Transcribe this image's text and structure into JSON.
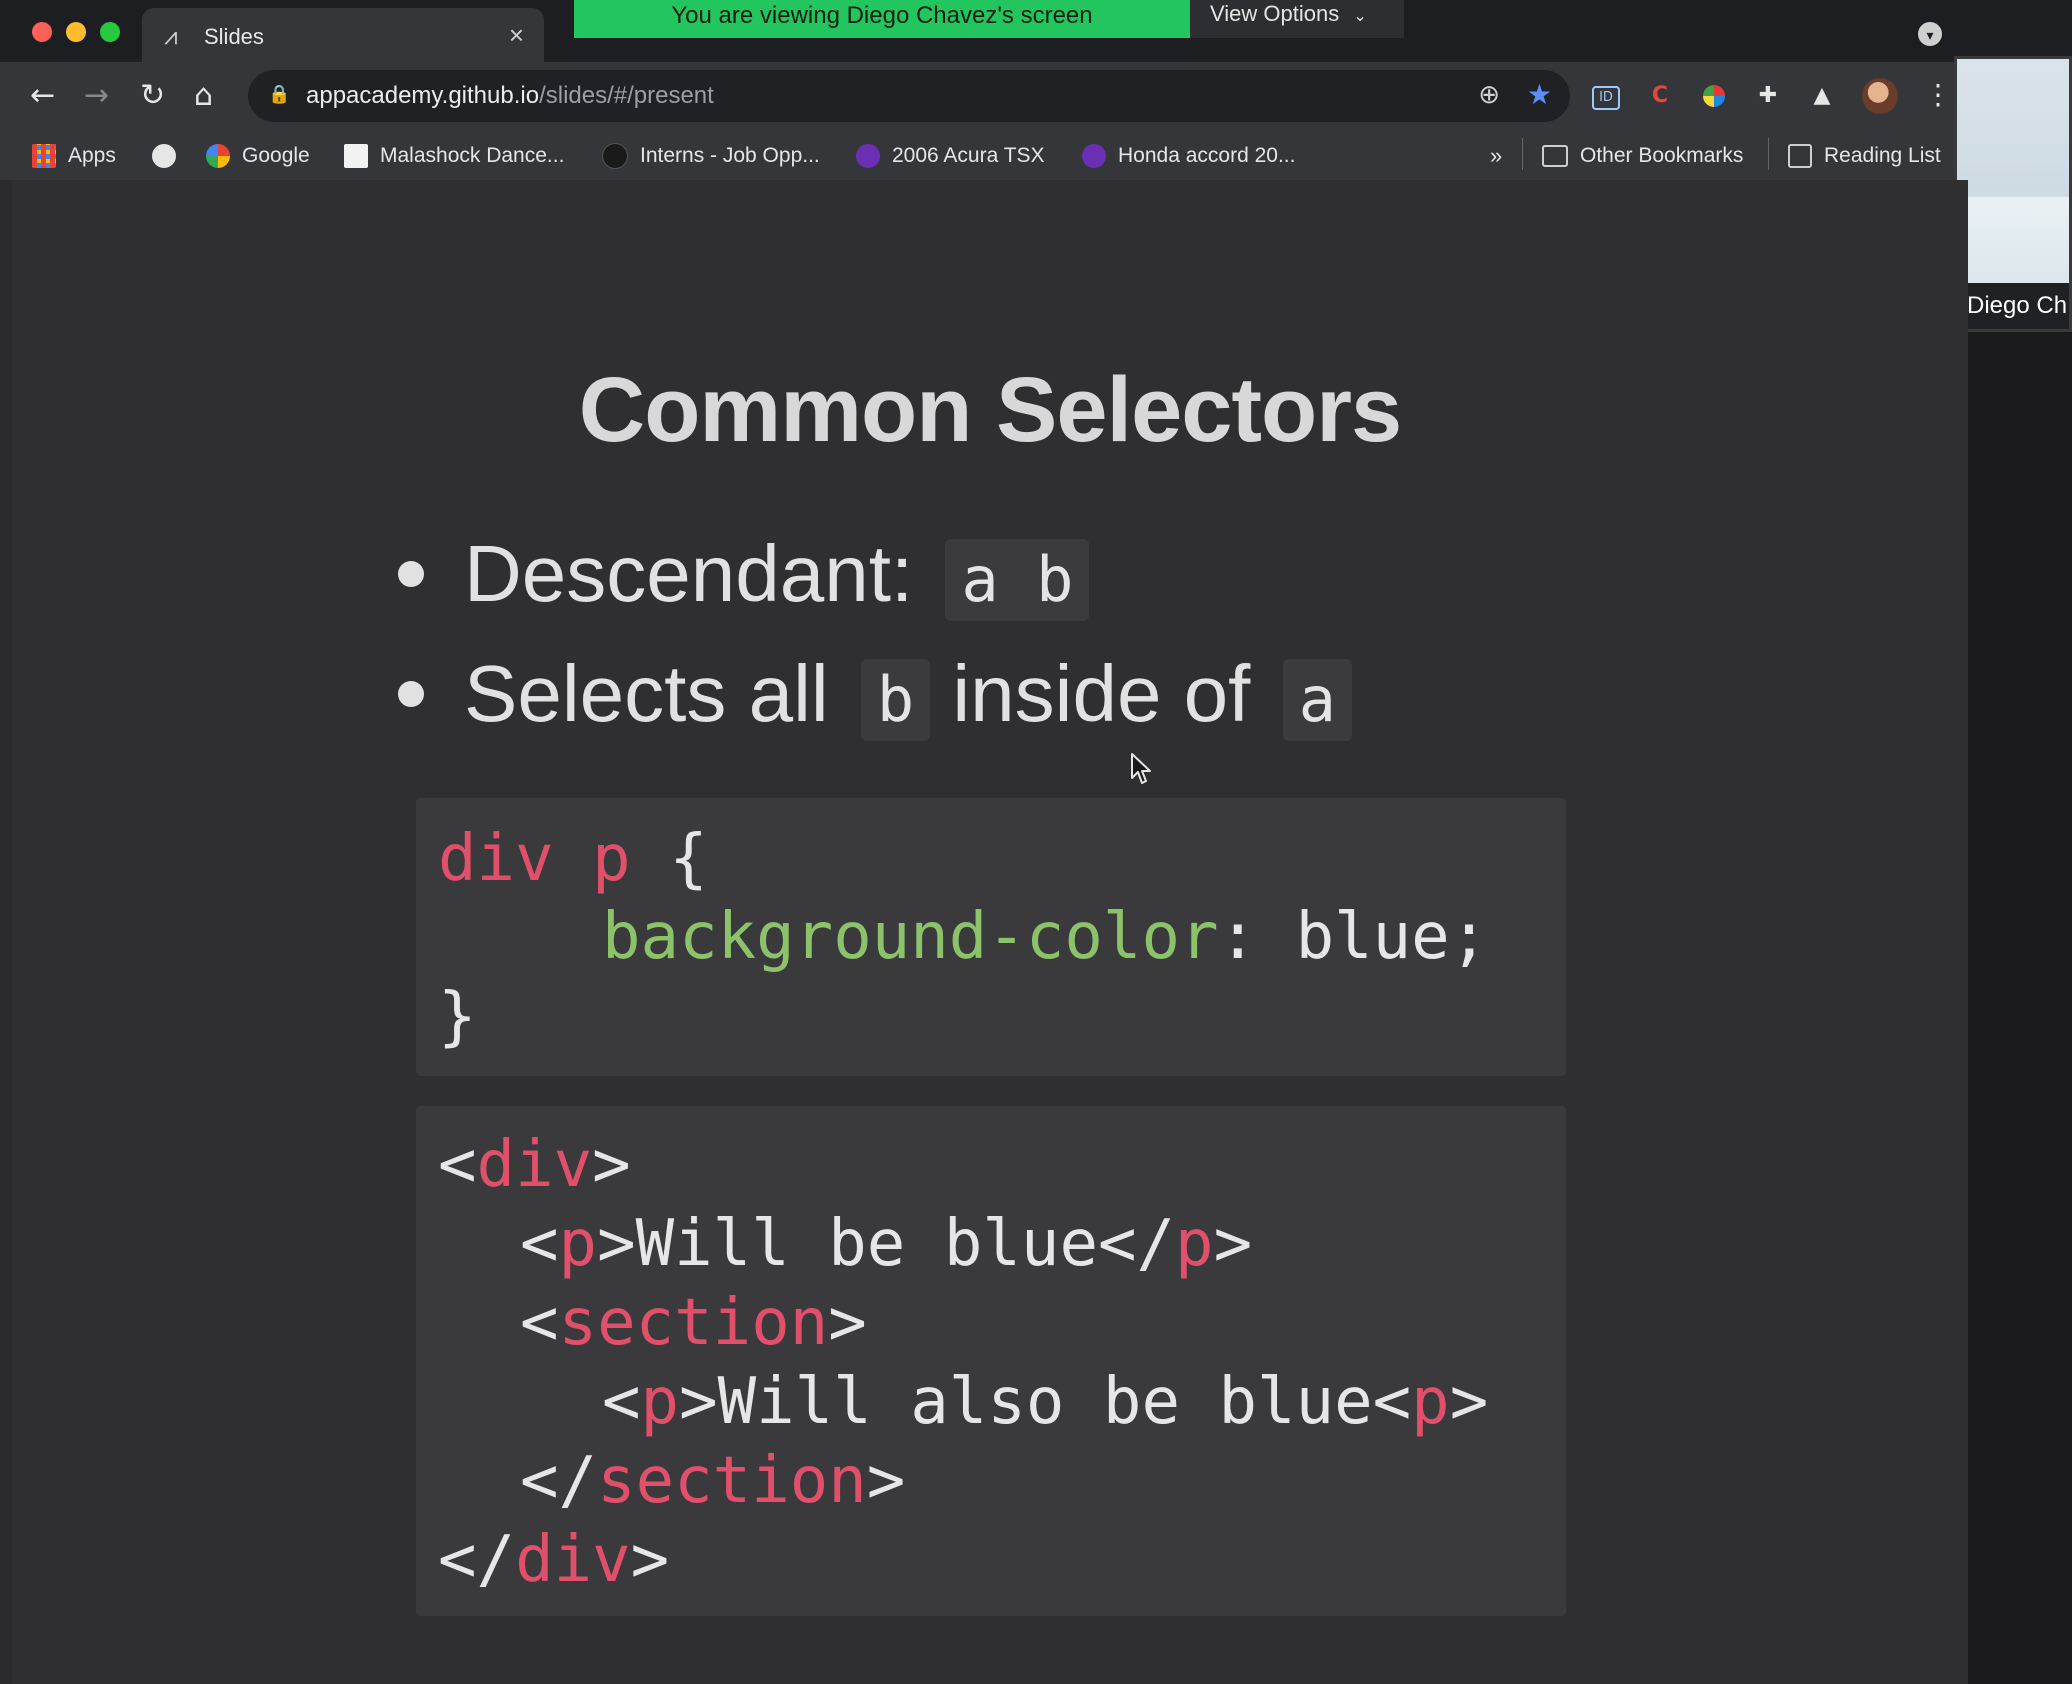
{
  "tab": {
    "title": "Slides"
  },
  "screen_share": {
    "banner": "You are viewing Diego Chavez's screen",
    "view_options": "View Options"
  },
  "address_bar": {
    "host": "appacademy.github.io",
    "path": "/slides/#/present"
  },
  "bookmarks": [
    {
      "label": "Apps",
      "icon": "apps-grid-icon"
    },
    {
      "label": "Google",
      "icon": "google-icon"
    },
    {
      "label": "Malashock Dance...",
      "icon": "page-icon"
    },
    {
      "label": "Interns - Job Opp...",
      "icon": "github-icon"
    },
    {
      "label": "2006 Acura TSX",
      "icon": "craigslist-icon"
    },
    {
      "label": "Honda accord 20...",
      "icon": "craigslist-icon"
    }
  ],
  "bookmarks_overflow": "»",
  "other_bookmarks": "Other Bookmarks",
  "reading_list": "Reading List",
  "participant": {
    "name": "Diego Ch"
  },
  "slide": {
    "title": "Common Selectors",
    "bullet1": {
      "text": "Descendant:",
      "code": "a b"
    },
    "bullet2": {
      "pre": "Selects all",
      "code1": "b",
      "mid": "inside of",
      "code2": "a"
    }
  },
  "css_block": {
    "line1_selector": "div p",
    "line1_brace": " {",
    "line2_property": "background-color",
    "line2_value": ": blue;",
    "line3": "}"
  },
  "html_block": {
    "l1_open": "<",
    "l1_tag": "div",
    "l1_close": ">",
    "l2_open": "<",
    "l2_tag": "p",
    "l2_text": ">Will be blue</",
    "l2_tag2": "p",
    "l2_close": ">",
    "l3_open": "<",
    "l3_tag": "section",
    "l3_close": ">",
    "l4_open": "<",
    "l4_tag": "p",
    "l4_text": ">Will also be blue<",
    "l4_tag2": "p",
    "l4_close": ">",
    "l5_open": "</",
    "l5_tag": "section",
    "l5_close": ">",
    "l6_open": "</",
    "l6_tag": "div",
    "l6_close": ">"
  },
  "colors": {
    "share_banner": "#23c55e",
    "code_keyword": "#e0506b",
    "code_property": "#8cc36a",
    "bookmark_star": "#5b8dff"
  }
}
